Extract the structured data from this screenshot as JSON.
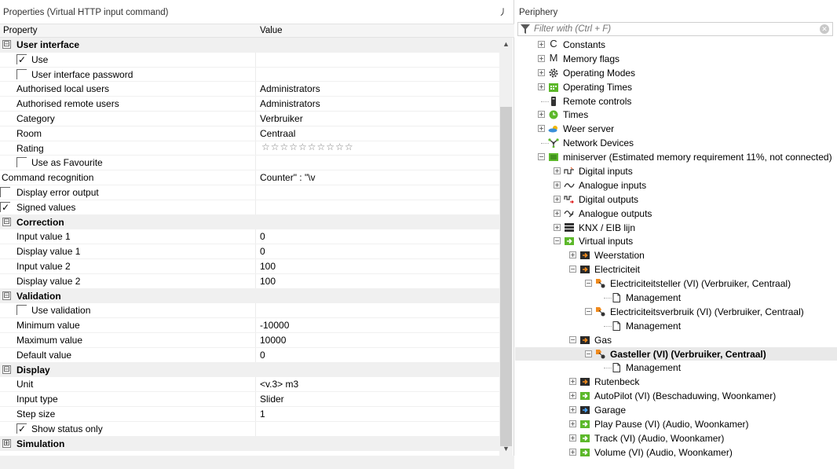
{
  "properties": {
    "title": "Properties (Virtual HTTP input command)",
    "pin_glyph": "⼃",
    "col_property": "Property",
    "col_value": "Value",
    "rows": [
      {
        "kind": "group",
        "name": "User interface",
        "expand": "⊟"
      },
      {
        "kind": "check",
        "name": "Use",
        "checked": "✓"
      },
      {
        "kind": "check",
        "name": "User interface password",
        "checked": ""
      },
      {
        "kind": "text",
        "name": "Authorised local users",
        "value": "Administrators"
      },
      {
        "kind": "text",
        "name": "Authorised remote users",
        "value": "Administrators"
      },
      {
        "kind": "text",
        "name": "Category",
        "value": "Verbruiker"
      },
      {
        "kind": "text",
        "name": "Room",
        "value": "Centraal"
      },
      {
        "kind": "rating",
        "name": "Rating",
        "stars": "☆☆☆☆☆☆☆☆☆☆"
      },
      {
        "kind": "check",
        "name": "Use as Favourite",
        "checked": ""
      },
      {
        "kind": "text0",
        "name": "Command recognition",
        "value": "Counter\" : \"\\v"
      },
      {
        "kind": "check0",
        "name": "Display error output",
        "checked": ""
      },
      {
        "kind": "check0",
        "name": "Signed values",
        "checked": "✓"
      },
      {
        "kind": "group",
        "name": "Correction",
        "expand": "⊟"
      },
      {
        "kind": "text",
        "name": "Input value 1",
        "value": "0"
      },
      {
        "kind": "text",
        "name": "Display value 1",
        "value": "0"
      },
      {
        "kind": "text",
        "name": "Input value 2",
        "value": "100"
      },
      {
        "kind": "text",
        "name": "Display value 2",
        "value": "100"
      },
      {
        "kind": "group",
        "name": "Validation",
        "expand": "⊟"
      },
      {
        "kind": "check",
        "name": "Use validation",
        "checked": ""
      },
      {
        "kind": "text",
        "name": "Minimum value",
        "value": "-10000"
      },
      {
        "kind": "text",
        "name": "Maximum value",
        "value": "10000"
      },
      {
        "kind": "text",
        "name": "Default value",
        "value": "0"
      },
      {
        "kind": "group",
        "name": "Display",
        "expand": "⊟"
      },
      {
        "kind": "text",
        "name": "Unit",
        "value": "<v.3> m3"
      },
      {
        "kind": "text",
        "name": "Input type",
        "value": "Slider"
      },
      {
        "kind": "text",
        "name": "Step size",
        "value": "1"
      },
      {
        "kind": "check",
        "name": "Show status only",
        "checked": "✓"
      },
      {
        "kind": "group",
        "name": "Simulation",
        "expand": "⊞"
      }
    ]
  },
  "periphery": {
    "title": "Periphery",
    "filter_placeholder": "Filter with (Ctrl + F)",
    "clear_glyph": "✕",
    "items": [
      {
        "label": "Constants",
        "level": 0,
        "exp": "+",
        "icon": "constant-c-icon",
        "glyph": "C"
      },
      {
        "label": "Memory flags",
        "level": 0,
        "exp": "+",
        "icon": "memory-flag-m-icon",
        "glyph": "M"
      },
      {
        "label": "Operating Modes",
        "level": 0,
        "exp": "+",
        "icon": "gear-icon"
      },
      {
        "label": "Operating Times",
        "level": 0,
        "exp": "+",
        "icon": "calendar-icon"
      },
      {
        "label": "Remote controls",
        "level": 0,
        "exp": "",
        "icon": "remote-control-icon"
      },
      {
        "label": "Times",
        "level": 0,
        "exp": "+",
        "icon": "clock-icon"
      },
      {
        "label": "Weer server",
        "level": 0,
        "exp": "+",
        "icon": "weather-cloud-icon"
      },
      {
        "label": "Network Devices",
        "level": 0,
        "exp": "",
        "icon": "network-icon"
      },
      {
        "label": "miniserver (Estimated memory requirement 11%, not connected)",
        "level": 0,
        "exp": "-",
        "icon": "miniserver-icon"
      },
      {
        "label": "Digital inputs",
        "level": 1,
        "exp": "+",
        "icon": "digital-input-icon"
      },
      {
        "label": "Analogue inputs",
        "level": 1,
        "exp": "+",
        "icon": "analogue-input-icon"
      },
      {
        "label": "Digital outputs",
        "level": 1,
        "exp": "+",
        "icon": "digital-output-icon"
      },
      {
        "label": "Analogue outputs",
        "level": 1,
        "exp": "+",
        "icon": "analogue-output-icon"
      },
      {
        "label": "KNX / EIB lijn",
        "level": 1,
        "exp": "+",
        "icon": "knx-icon"
      },
      {
        "label": "Virtual inputs",
        "level": 1,
        "exp": "-",
        "icon": "virtual-input-green-icon"
      },
      {
        "label": "Weerstation",
        "level": 2,
        "exp": "+",
        "icon": "virtual-input-dark-orange-icon"
      },
      {
        "label": "Electriciteit",
        "level": 2,
        "exp": "-",
        "icon": "virtual-input-dark-orange-icon"
      },
      {
        "label": "Electriciteitsteller (VI) (Verbruiker, Centraal)",
        "level": 3,
        "exp": "-",
        "icon": "virtual-http-input-icon"
      },
      {
        "label": "Management",
        "level": 4,
        "exp": "",
        "icon": "document-icon"
      },
      {
        "label": "Electriciteitsverbruik (VI) (Verbruiker, Centraal)",
        "level": 3,
        "exp": "-",
        "icon": "virtual-http-input-icon"
      },
      {
        "label": "Management",
        "level": 4,
        "exp": "",
        "icon": "document-icon"
      },
      {
        "label": "Gas",
        "level": 2,
        "exp": "-",
        "icon": "virtual-input-dark-orange-icon"
      },
      {
        "label": "Gasteller (VI) (Verbruiker, Centraal)",
        "level": 3,
        "exp": "-",
        "icon": "virtual-http-input-icon",
        "selected": true
      },
      {
        "label": "Management",
        "level": 4,
        "exp": "",
        "icon": "document-icon"
      },
      {
        "label": "Rutenbeck",
        "level": 2,
        "exp": "+",
        "icon": "virtual-input-dark-orange-icon"
      },
      {
        "label": "AutoPilot (VI) (Beschaduwing, Woonkamer)",
        "level": 2,
        "exp": "+",
        "icon": "virtual-input-green-icon"
      },
      {
        "label": "Garage",
        "level": 2,
        "exp": "+",
        "icon": "virtual-input-dark-blue-icon"
      },
      {
        "label": "Play Pause (VI) (Audio, Woonkamer)",
        "level": 2,
        "exp": "+",
        "icon": "virtual-input-green-icon"
      },
      {
        "label": "Track (VI) (Audio, Woonkamer)",
        "level": 2,
        "exp": "+",
        "icon": "virtual-input-green-icon"
      },
      {
        "label": "Volume (VI) (Audio, Woonkamer)",
        "level": 2,
        "exp": "+",
        "icon": "virtual-input-green-icon"
      }
    ]
  },
  "colors": {
    "selection": "#e9e9e9",
    "group_bg": "#f0f0f0",
    "green": "#3cb01f",
    "orange": "#f08a1c",
    "dark": "#2a2a2a"
  }
}
